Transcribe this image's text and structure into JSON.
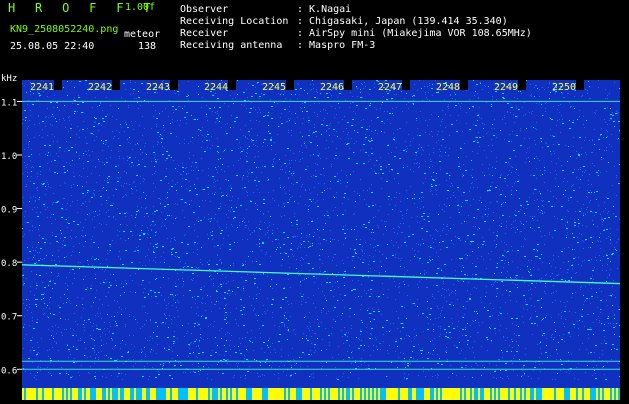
{
  "header": {
    "brand": "H R O F F T",
    "version": "1.00f",
    "filename": "KN9_2508052240.png",
    "mode": "meteor",
    "datetime": "25.08.05 22:40",
    "count": "138"
  },
  "info": {
    "rows": [
      {
        "label": "Observer",
        "value": ": K.Nagai"
      },
      {
        "label": "Receiving Location",
        "value": ": Chigasaki, Japan (139.414 35.340)"
      },
      {
        "label": "Receiver",
        "value": ": AirSpy mini (Miakejima VOR 108.65MHz)"
      },
      {
        "label": "Receiving antenna",
        "value": ": Maspro FM-3"
      }
    ]
  },
  "chart_data": {
    "type": "heatmap",
    "ylabel": "kHz",
    "x_ticks": [
      "2241",
      "2242",
      "2243",
      "2244",
      "2245",
      "2246",
      "2247",
      "2248",
      "2249",
      "2250"
    ],
    "y_ticks": [
      "1.1",
      "1.0",
      "0.9",
      "0.8",
      "0.7",
      "0.6"
    ],
    "y_tick_values": [
      1.1,
      1.0,
      0.9,
      0.8,
      0.7,
      0.6
    ],
    "ylim": [
      0.58,
      1.14
    ],
    "horizontal_lines_khz": [
      1.1,
      0.615,
      0.6
    ],
    "drift_line_khz": {
      "start": 0.795,
      "end": 0.76
    },
    "colors": {
      "background": "#1030c0",
      "noise_low": "#2060ff",
      "noise_high": "#00e0ff",
      "signal": "#40ffd0",
      "tick_label": "#ffff40",
      "tick_label_bg": "#000000",
      "bottom_band": "#ffff00"
    }
  }
}
